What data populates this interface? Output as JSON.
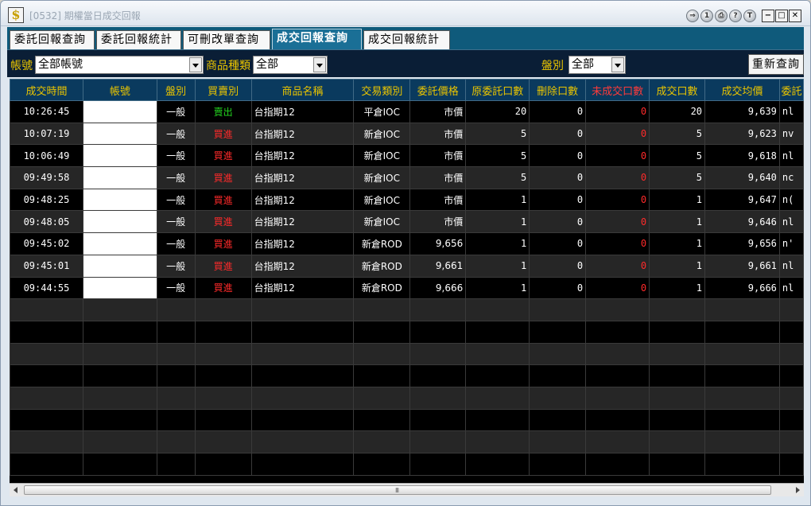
{
  "window": {
    "title": "[0532] 期權當日成交回報",
    "icon": "dollar-sign-icon",
    "title_buttons": [
      "back-icon",
      "info-icon",
      "print-icon",
      "help-icon",
      "tools-icon"
    ],
    "title_button_glyphs": [
      "⇒",
      "1",
      "⎙",
      "?",
      "T"
    ],
    "win_glyphs": {
      "minimize": "−",
      "maximize": "□",
      "close": "✕"
    }
  },
  "tabs": [
    {
      "label": "委託回報查詢",
      "active": false
    },
    {
      "label": "委託回報統計",
      "active": false
    },
    {
      "label": "可刪改單查詢",
      "active": false
    },
    {
      "label": "成交回報查詢",
      "active": true
    },
    {
      "label": "成交回報統計",
      "active": false
    }
  ],
  "filters": {
    "account_label": "帳號",
    "account_value": "全部帳號",
    "product_label": "商品種類",
    "product_value": "全部",
    "session_label": "盤別",
    "session_value": "全部",
    "requery_label": "重新查詢"
  },
  "table": {
    "headers": [
      "成交時間",
      "帳號",
      "盤別",
      "買賣別",
      "商品名稱",
      "交易類別",
      "委託價格",
      "原委託口數",
      "刪除口數",
      "未成交口數",
      "成交口數",
      "成交均價",
      "委託"
    ],
    "rows": [
      [
        "10:26:45",
        "",
        "一般",
        "賣出",
        "台指期12",
        "平倉IOC",
        "市價",
        "20",
        "0",
        "0",
        "20",
        "9,639",
        "nl"
      ],
      [
        "10:07:19",
        "",
        "一般",
        "買進",
        "台指期12",
        "新倉IOC",
        "市價",
        "5",
        "0",
        "0",
        "5",
        "9,623",
        "nv"
      ],
      [
        "10:06:49",
        "",
        "一般",
        "買進",
        "台指期12",
        "新倉IOC",
        "市價",
        "5",
        "0",
        "0",
        "5",
        "9,618",
        "nl"
      ],
      [
        "09:49:58",
        "",
        "一般",
        "買進",
        "台指期12",
        "新倉IOC",
        "市價",
        "5",
        "0",
        "0",
        "5",
        "9,640",
        "nc"
      ],
      [
        "09:48:25",
        "",
        "一般",
        "買進",
        "台指期12",
        "新倉IOC",
        "市價",
        "1",
        "0",
        "0",
        "1",
        "9,647",
        "n("
      ],
      [
        "09:48:05",
        "",
        "一般",
        "買進",
        "台指期12",
        "新倉IOC",
        "市價",
        "1",
        "0",
        "0",
        "1",
        "9,646",
        "nl"
      ],
      [
        "09:45:02",
        "",
        "一般",
        "買進",
        "台指期12",
        "新倉ROD",
        "9,656",
        "1",
        "0",
        "0",
        "1",
        "9,656",
        "n'"
      ],
      [
        "09:45:01",
        "",
        "一般",
        "買進",
        "台指期12",
        "新倉ROD",
        "9,661",
        "1",
        "0",
        "0",
        "1",
        "9,661",
        "nl"
      ],
      [
        "09:44:55",
        "",
        "一般",
        "買進",
        "台指期12",
        "新倉ROD",
        "9,666",
        "1",
        "0",
        "0",
        "1",
        "9,666",
        "nl"
      ]
    ]
  },
  "colors": {
    "header_text": "#e9c400",
    "sell": "#23d41f",
    "buy": "#ff2a2a",
    "unfilled": "#ff2a2a",
    "tab_bar": "#0f5a7b"
  },
  "scrollbar": {
    "grip": "III"
  }
}
